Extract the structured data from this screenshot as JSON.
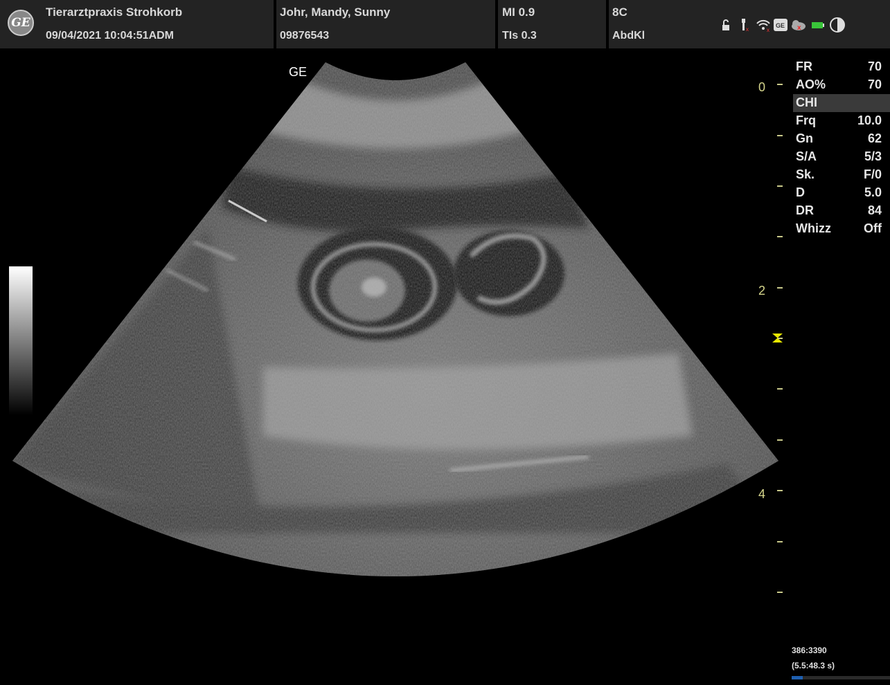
{
  "header": {
    "clinic": "Tierarztpraxis Strohkorb",
    "datetime": "09/04/2021 10:04:51ADM",
    "patient": "Johr, Mandy, Sunny",
    "patient_id": "09876543",
    "mi": "MI 0.9",
    "tis": "TIs 0.3",
    "probe": "8C",
    "preset": "AbdKl",
    "logo": "GE"
  },
  "image": {
    "orientation_mark": "GE"
  },
  "params": [
    {
      "k": "FR",
      "v": "70"
    },
    {
      "k": "AO%",
      "v": "70"
    },
    {
      "k": "CHI",
      "v": ""
    },
    {
      "k": "Frq",
      "v": "10.0"
    },
    {
      "k": "Gn",
      "v": "62"
    },
    {
      "k": "S/A",
      "v": "5/3"
    },
    {
      "k": "Sk.",
      "v": "F/0"
    },
    {
      "k": "D",
      "v": "5.0"
    },
    {
      "k": "DR",
      "v": "84"
    },
    {
      "k": "Whizz",
      "v": "Off"
    }
  ],
  "depth_scale": {
    "labels": [
      "0",
      "2",
      "4"
    ]
  },
  "cine": {
    "frames": "386:3390",
    "time": "(5.5:48.3 s)",
    "progress": 0.11
  },
  "icons": [
    "lock-icon",
    "usb-icon",
    "wifi-icon",
    "ge-network-icon",
    "cloud-icon",
    "battery-icon",
    "brightness-icon"
  ],
  "colors": {
    "scale_accent": "#d6d68c",
    "focus_marker": "#e8e800",
    "cine_bar": "#1e5fb0"
  }
}
